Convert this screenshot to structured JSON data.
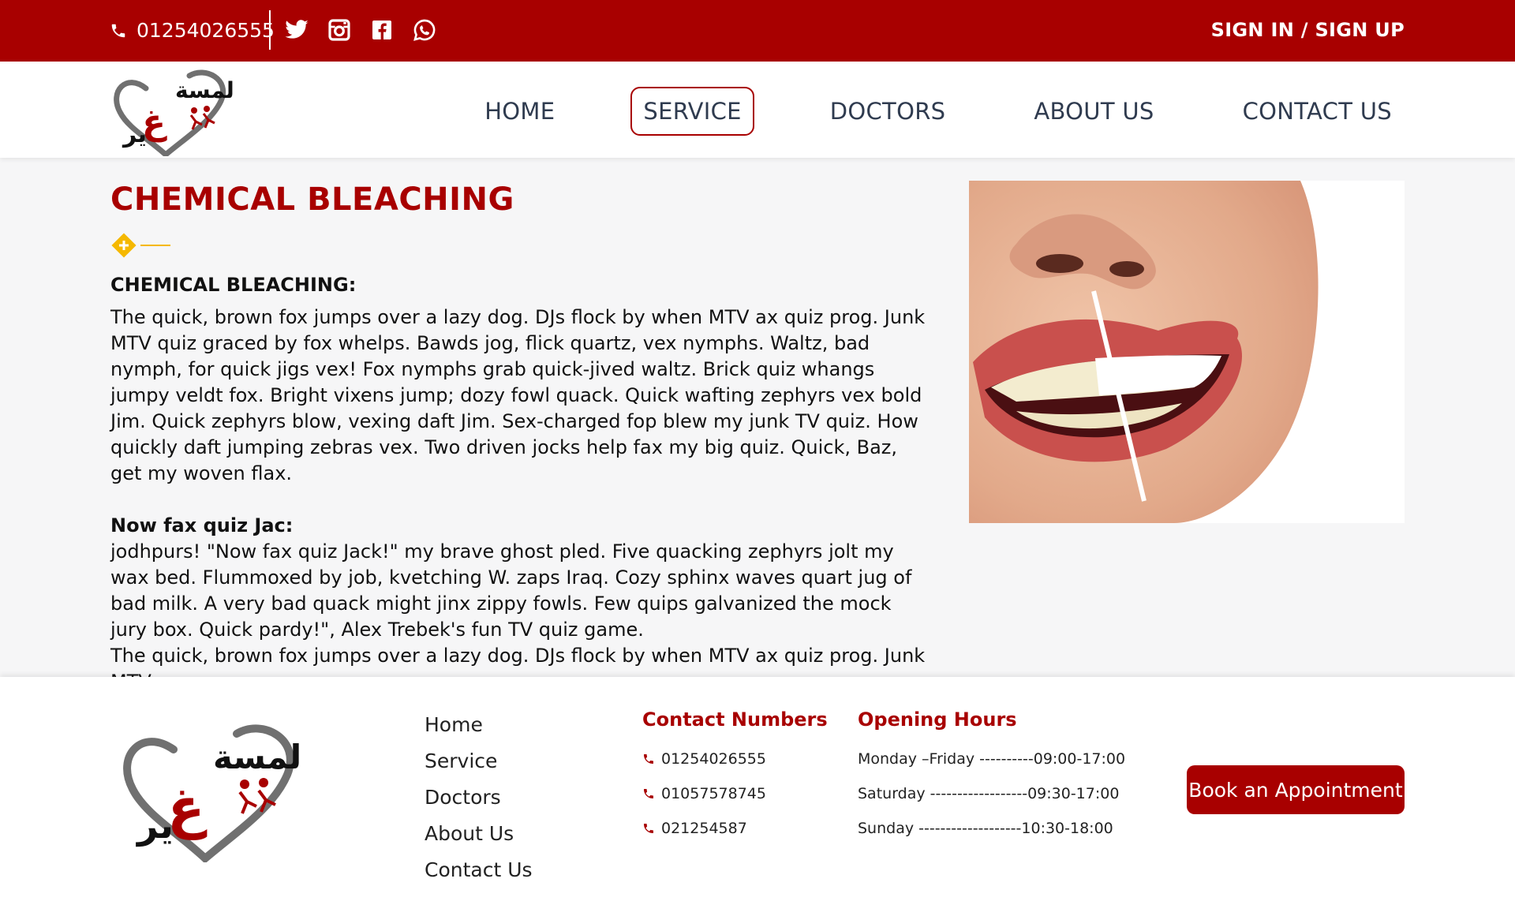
{
  "topbar": {
    "phone": "01254026555",
    "icons": [
      "phone-icon",
      "twitter-icon",
      "instagram-icon",
      "facebook-icon",
      "whatsapp-icon"
    ],
    "signin_label": "SIGN IN / SIGN UP"
  },
  "header": {
    "nav": [
      {
        "label": "HOME",
        "active": false
      },
      {
        "label": "SERVICE",
        "active": true
      },
      {
        "label": "DOCTORS",
        "active": false
      },
      {
        "label": "ABOUT US",
        "active": false
      },
      {
        "label": "CONTACT US",
        "active": false
      }
    ]
  },
  "main": {
    "title": "CHEMICAL BLEACHING",
    "section1_heading": "CHEMICAL BLEACHING:",
    "section1_body": "The quick, brown fox jumps over a lazy dog. DJs flock by when MTV ax quiz prog. Junk MTV quiz graced by fox whelps. Bawds jog, flick quartz, vex nymphs. Waltz, bad nymph, for quick jigs vex! Fox nymphs grab quick-jived waltz. Brick quiz whangs jumpy veldt fox. Bright vixens jump; dozy fowl quack. Quick wafting zephyrs vex bold Jim. Quick zephyrs blow, vexing daft Jim. Sex-charged fop blew my junk TV quiz. How quickly daft jumping zebras vex. Two driven jocks help fax my big quiz. Quick, Baz, get my woven flax.",
    "section2_heading": "Now fax quiz Jac:",
    "section2_body": "jodhpurs! \"Now fax quiz Jack!\" my brave ghost pled. Five quacking zephyrs jolt my wax bed. Flummoxed by job, kvetching W. zaps Iraq. Cozy sphinx waves quart jug of bad milk. A very bad quack might jinx zippy fowls. Few quips galvanized the mock jury box. Quick pardy!\", Alex Trebek's fun TV quiz game.",
    "section2_tail": "The quick, brown fox jumps over a lazy dog. DJs flock by when MTV ax quiz prog. Junk MTV"
  },
  "footer": {
    "links": [
      "Home",
      "Service",
      "Doctors",
      "About Us",
      "Contact Us"
    ],
    "contacts_title": "Contact Numbers",
    "contacts": [
      "01254026555",
      "01057578745",
      "021254587"
    ],
    "hours_title": "Opening Hours",
    "hours": [
      "Monday –Friday ----------09:00-17:00",
      "Saturday ------------------09:30-17:00",
      "Sunday -------------------10:30-18:00"
    ],
    "book_label": "Book an Appointment"
  },
  "colors": {
    "brand_red": "#a80000",
    "accent_yellow": "#f5b800",
    "nav_text": "#2f3b4f"
  }
}
